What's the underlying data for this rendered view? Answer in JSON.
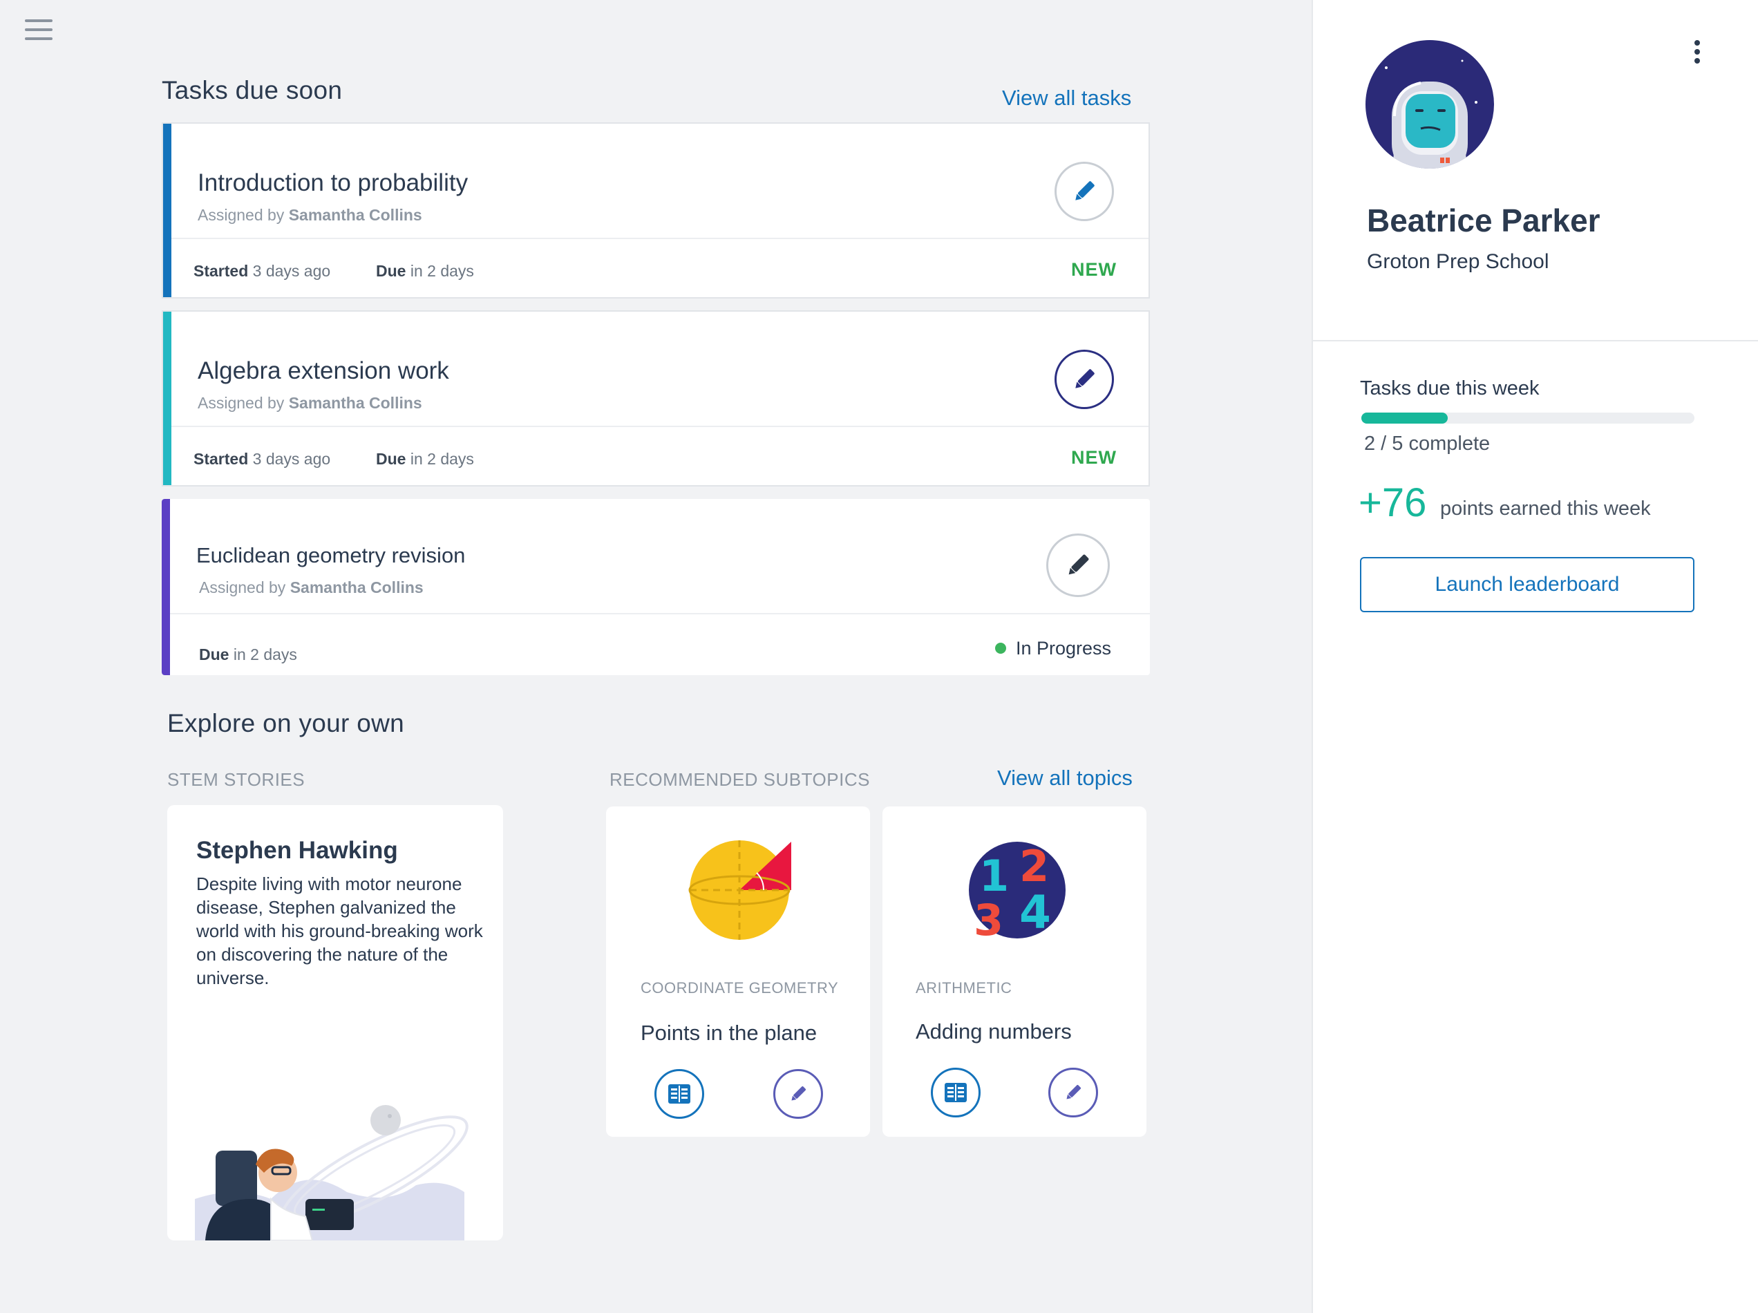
{
  "tasks_section": {
    "title": "Tasks due soon",
    "view_all": "View all tasks",
    "tasks": [
      {
        "title": "Introduction to probability",
        "assigned_prefix": "Assigned by",
        "assigned_by": "Samantha Collins",
        "started_label": "Started",
        "started_value": "3 days ago",
        "due_label": "Due",
        "due_value": "in 2 days",
        "status": "NEW",
        "stripe_color": "#1473bb"
      },
      {
        "title": "Algebra extension work",
        "assigned_prefix": "Assigned by",
        "assigned_by": "Samantha Collins",
        "started_label": "Started",
        "started_value": "3 days ago",
        "due_label": "Due",
        "due_value": "in 2 days",
        "status": "NEW",
        "stripe_color": "#22b8c2"
      },
      {
        "title": "Euclidean geometry revision",
        "assigned_prefix": "Assigned by",
        "assigned_by": "Samantha Collins",
        "due_label": "Due",
        "due_value": "in 2 days",
        "status": "In Progress",
        "stripe_color": "#5b3fc4"
      }
    ]
  },
  "explore_section": {
    "title": "Explore on your own",
    "stem_label": "STEM STORIES",
    "subtopics_label": "RECOMMENDED SUBTOPICS",
    "view_all": "View all topics",
    "story": {
      "title": "Stephen Hawking",
      "text": "Despite living with motor neurone disease, Stephen galvanized the world with his ground-breaking work on discovering the nature of the universe."
    },
    "subtopics": [
      {
        "category": "COORDINATE GEOMETRY",
        "title": "Points in the plane"
      },
      {
        "category": "ARITHMETIC",
        "title": "Adding numbers"
      }
    ]
  },
  "profile": {
    "name": "Beatrice Parker",
    "school": "Groton Prep School"
  },
  "weekly": {
    "title": "Tasks due this week",
    "progress_fraction": 0.4,
    "complete_text": "2 / 5 complete",
    "points": "+76",
    "points_text": "points earned this week",
    "leaderboard_button": "Launch leaderboard"
  },
  "colors": {
    "accent_blue": "#1473bb",
    "teal": "#17b79a",
    "new_green": "#2fa84f"
  }
}
